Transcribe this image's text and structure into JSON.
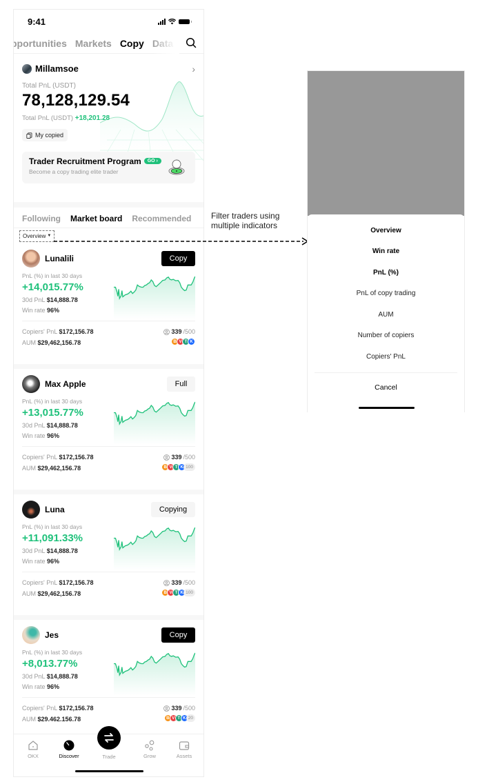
{
  "status_bar": {
    "time": "9:41"
  },
  "top_nav": {
    "tabs": [
      {
        "label": "pportunities",
        "active": false
      },
      {
        "label": "Markets",
        "active": false
      },
      {
        "label": "Copy",
        "active": true
      },
      {
        "label": "Data",
        "active": false
      }
    ],
    "search_icon": "search-icon"
  },
  "account": {
    "name": "Millamsoe",
    "total_pnl_label": "Total PnL (USDT)",
    "total_pnl_value": "78,128,129.54",
    "sub_label": "Total PnL (USDT)",
    "sub_value": "+18,201.28",
    "my_copied_label": "My copied"
  },
  "recruitment": {
    "title": "Trader Recruitment Program",
    "badge": "GO",
    "subtitle": "Become a copy trading elite trader"
  },
  "sub_tabs": [
    {
      "label": "Following",
      "active": false
    },
    {
      "label": "Market board",
      "active": true
    },
    {
      "label": "Recommended",
      "active": false
    }
  ],
  "filter": {
    "selected": "Overview"
  },
  "traders": [
    {
      "name": "Lunalili",
      "action": "Copy",
      "action_style": "dark",
      "pnl_label": "PnL (%) in last 30 days",
      "pnl_pct": "+14,015.77%",
      "pnl_30d_label": "30d PnL",
      "pnl_30d": "$14,888.78",
      "win_rate_label": "Win rate",
      "win_rate": "96%",
      "copiers_pnl_label": "Copiers' PnL",
      "copiers_pnl": "$172,156.78",
      "aum_label": "AUM",
      "aum": "$29,462,156.78",
      "copiers": "339",
      "copiers_max": "/500",
      "coins_more": ""
    },
    {
      "name": "Max Apple",
      "action": "Full",
      "action_style": "light",
      "pnl_label": "PnL (%) in last 30 days",
      "pnl_pct": "+13,015.77%",
      "pnl_30d_label": "30d PnL",
      "pnl_30d": "$14,888.78",
      "win_rate_label": "Win rate",
      "win_rate": "96%",
      "copiers_pnl_label": "Copiers' PnL",
      "copiers_pnl": "$172,156.78",
      "aum_label": "AUM",
      "aum": "$29,462,156.78",
      "copiers": "339",
      "copiers_max": "/500",
      "coins_more": "100"
    },
    {
      "name": "Luna",
      "action": "Copying",
      "action_style": "light",
      "pnl_label": "PnL (%) in last 30 days",
      "pnl_pct": "+11,091.33%",
      "pnl_30d_label": "30d PnL",
      "pnl_30d": "$14,888.78",
      "win_rate_label": "Win rate",
      "win_rate": "96%",
      "copiers_pnl_label": "Copiers' PnL",
      "copiers_pnl": "$172,156.78",
      "aum_label": "AUM",
      "aum": "$29,462,156.78",
      "copiers": "339",
      "copiers_max": "/500",
      "coins_more": "100"
    },
    {
      "name": "Jes",
      "action": "Copy",
      "action_style": "dark",
      "pnl_label": "PnL (%) in last 30 days",
      "pnl_pct": "+8,013.77%",
      "pnl_30d_label": "30d PnL",
      "pnl_30d": "$14,888.78",
      "win_rate_label": "Win rate",
      "win_rate": "96%",
      "copiers_pnl_label": "Copiers' PnL",
      "copiers_pnl": "$172,156.78",
      "aum_label": "AUM",
      "aum": "$29.462.156.78",
      "copiers": "339",
      "copiers_max": "/500",
      "coins_more": "20"
    }
  ],
  "coins": [
    {
      "letter": "B",
      "color": "#f7931a"
    },
    {
      "letter": "V",
      "color": "#e84142"
    },
    {
      "letter": "T",
      "color": "#26a17b"
    },
    {
      "letter": "K",
      "color": "#1e6bff"
    }
  ],
  "bottom_nav": [
    {
      "label": "OKX",
      "active": false
    },
    {
      "label": "Discover",
      "active": true
    },
    {
      "label": "Trade",
      "active": false
    },
    {
      "label": "Grow",
      "active": false
    },
    {
      "label": "Assets",
      "active": false
    }
  ],
  "annotation": {
    "text_line1": "Filter traders using",
    "text_line2": "multiple indicators"
  },
  "filter_sheet": {
    "options": [
      {
        "label": "Overview",
        "bold": true
      },
      {
        "label": "Win rate",
        "bold": true
      },
      {
        "label": "PnL (%)",
        "bold": true
      },
      {
        "label": "PnL of copy trading",
        "bold": false
      },
      {
        "label": "AUM",
        "bold": false
      },
      {
        "label": "Number of copiers",
        "bold": false
      },
      {
        "label": "Copiers' PnL",
        "bold": false
      }
    ],
    "cancel": "Cancel"
  },
  "colors": {
    "accent_green": "#1fc17b",
    "dim_overlay": "#989898"
  }
}
